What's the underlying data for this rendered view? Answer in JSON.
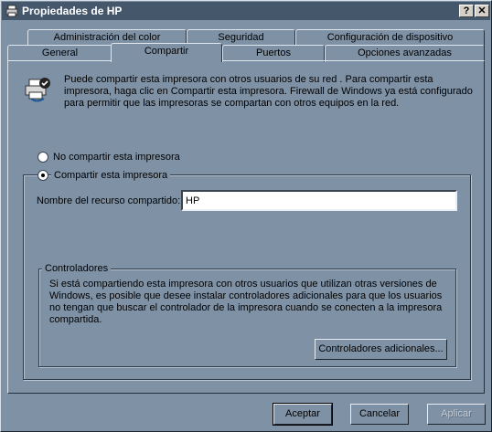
{
  "window": {
    "title": "Propiedades de HP",
    "help_label": "?",
    "close_label": "✕"
  },
  "tabs_back": [
    "Administración del color",
    "Seguridad",
    "Configuración de dispositivo"
  ],
  "tabs_front": [
    "General",
    "Compartir",
    "Puertos",
    "Opciones avanzadas"
  ],
  "active_tab": "Compartir",
  "info_text": "Puede compartir esta impresora con otros usuarios de su red . Para compartir esta impresora, haga clic en Compartir esta impresora.  Firewall de Windows ya está configurado para permitir que las impresoras se compartan con otros equipos en la red.",
  "sharing": {
    "no_share_label": "No compartir esta impresora",
    "share_label": "Compartir esta impresora",
    "selected": "share",
    "share_name_label": "Nombre del recurso compartido:",
    "share_name_value": "HP"
  },
  "drivers": {
    "group_label": "Controladores",
    "description": "Si está compartiendo esta impresora con otros usuarios que utilizan otras versiones de Windows, es posible que desee instalar controladores adicionales para que los usuarios no tengan que buscar el controlador de la impresora cuando se conecten a la impresora compartida.",
    "button_label": "Controladores adicionales..."
  },
  "footer": {
    "ok_label": "Aceptar",
    "cancel_label": "Cancelar",
    "apply_label": "Aplicar"
  },
  "icons": {
    "app": "printer-icon",
    "info": "shared-printer-icon"
  }
}
